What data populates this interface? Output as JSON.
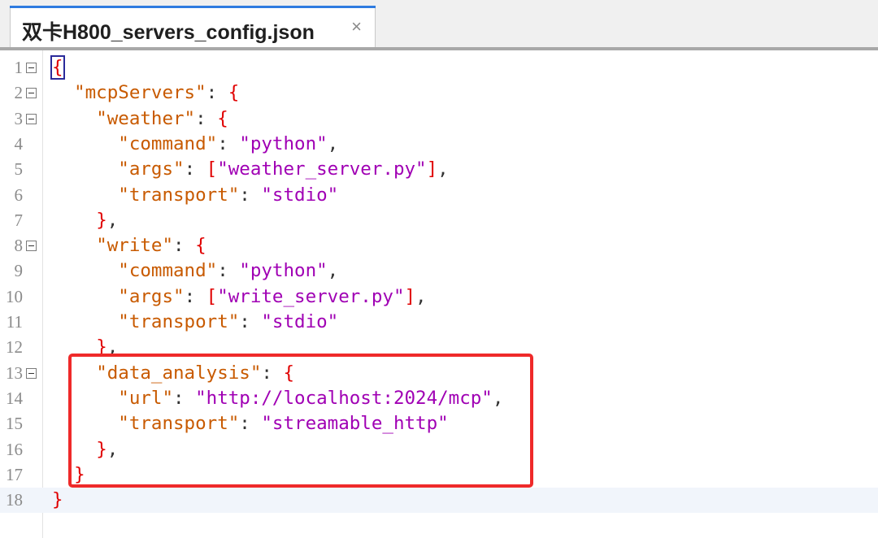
{
  "tab": {
    "title": "双卡H800_servers_config.json",
    "close_glyph": "×"
  },
  "editor": {
    "current_line": 18,
    "lines": [
      {
        "n": "1",
        "fold": true,
        "tokens": [
          {
            "t": "{",
            "c": "p",
            "cursor": true
          }
        ]
      },
      {
        "n": "2",
        "fold": true,
        "tokens": [
          {
            "t": "  "
          },
          {
            "t": "\"mcpServers\"",
            "c": "k"
          },
          {
            "t": ": ",
            "c": "d"
          },
          {
            "t": "{",
            "c": "p"
          }
        ]
      },
      {
        "n": "3",
        "fold": true,
        "tokens": [
          {
            "t": "    "
          },
          {
            "t": "\"weather\"",
            "c": "k"
          },
          {
            "t": ": ",
            "c": "d"
          },
          {
            "t": "{",
            "c": "p"
          }
        ]
      },
      {
        "n": "4",
        "fold": false,
        "tokens": [
          {
            "t": "      "
          },
          {
            "t": "\"command\"",
            "c": "k"
          },
          {
            "t": ": ",
            "c": "d"
          },
          {
            "t": "\"python\"",
            "c": "s"
          },
          {
            "t": ",",
            "c": "d"
          }
        ]
      },
      {
        "n": "5",
        "fold": false,
        "tokens": [
          {
            "t": "      "
          },
          {
            "t": "\"args\"",
            "c": "k"
          },
          {
            "t": ": ",
            "c": "d"
          },
          {
            "t": "[",
            "c": "p"
          },
          {
            "t": "\"weather_server.py\"",
            "c": "s"
          },
          {
            "t": "]",
            "c": "p"
          },
          {
            "t": ",",
            "c": "d"
          }
        ]
      },
      {
        "n": "6",
        "fold": false,
        "tokens": [
          {
            "t": "      "
          },
          {
            "t": "\"transport\"",
            "c": "k"
          },
          {
            "t": ": ",
            "c": "d"
          },
          {
            "t": "\"stdio\"",
            "c": "s"
          }
        ]
      },
      {
        "n": "7",
        "fold": false,
        "tokens": [
          {
            "t": "    "
          },
          {
            "t": "}",
            "c": "p"
          },
          {
            "t": ",",
            "c": "d"
          }
        ]
      },
      {
        "n": "8",
        "fold": true,
        "tokens": [
          {
            "t": "    "
          },
          {
            "t": "\"write\"",
            "c": "k"
          },
          {
            "t": ": ",
            "c": "d"
          },
          {
            "t": "{",
            "c": "p"
          }
        ]
      },
      {
        "n": "9",
        "fold": false,
        "tokens": [
          {
            "t": "      "
          },
          {
            "t": "\"command\"",
            "c": "k"
          },
          {
            "t": ": ",
            "c": "d"
          },
          {
            "t": "\"python\"",
            "c": "s"
          },
          {
            "t": ",",
            "c": "d"
          }
        ]
      },
      {
        "n": "10",
        "fold": false,
        "tokens": [
          {
            "t": "      "
          },
          {
            "t": "\"args\"",
            "c": "k"
          },
          {
            "t": ": ",
            "c": "d"
          },
          {
            "t": "[",
            "c": "p"
          },
          {
            "t": "\"write_server.py\"",
            "c": "s"
          },
          {
            "t": "]",
            "c": "p"
          },
          {
            "t": ",",
            "c": "d"
          }
        ]
      },
      {
        "n": "11",
        "fold": false,
        "tokens": [
          {
            "t": "      "
          },
          {
            "t": "\"transport\"",
            "c": "k"
          },
          {
            "t": ": ",
            "c": "d"
          },
          {
            "t": "\"stdio\"",
            "c": "s"
          }
        ]
      },
      {
        "n": "12",
        "fold": false,
        "tokens": [
          {
            "t": "    "
          },
          {
            "t": "}",
            "c": "p"
          },
          {
            "t": ",",
            "c": "d"
          }
        ]
      },
      {
        "n": "13",
        "fold": true,
        "tokens": [
          {
            "t": "    "
          },
          {
            "t": "\"data_analysis\"",
            "c": "k"
          },
          {
            "t": ": ",
            "c": "d"
          },
          {
            "t": "{",
            "c": "p"
          }
        ]
      },
      {
        "n": "14",
        "fold": false,
        "tokens": [
          {
            "t": "      "
          },
          {
            "t": "\"url\"",
            "c": "k"
          },
          {
            "t": ": ",
            "c": "d"
          },
          {
            "t": "\"http://localhost:2024/mcp\"",
            "c": "s"
          },
          {
            "t": ",",
            "c": "d"
          }
        ]
      },
      {
        "n": "15",
        "fold": false,
        "tokens": [
          {
            "t": "      "
          },
          {
            "t": "\"transport\"",
            "c": "k"
          },
          {
            "t": ": ",
            "c": "d"
          },
          {
            "t": "\"streamable_http\"",
            "c": "s"
          }
        ]
      },
      {
        "n": "16",
        "fold": false,
        "tokens": [
          {
            "t": "    "
          },
          {
            "t": "}",
            "c": "p"
          },
          {
            "t": ",",
            "c": "d"
          }
        ]
      },
      {
        "n": "17",
        "fold": false,
        "tokens": [
          {
            "t": "  "
          },
          {
            "t": "}",
            "c": "p"
          }
        ]
      },
      {
        "n": "18",
        "fold": false,
        "tokens": [
          {
            "t": "}",
            "c": "p"
          }
        ]
      }
    ]
  },
  "colors": {
    "key": "#c85a00",
    "string": "#a000b4",
    "punct": "#e00000",
    "highlight_box": "#ef2a2a",
    "tab_accent": "#2e7be0"
  }
}
